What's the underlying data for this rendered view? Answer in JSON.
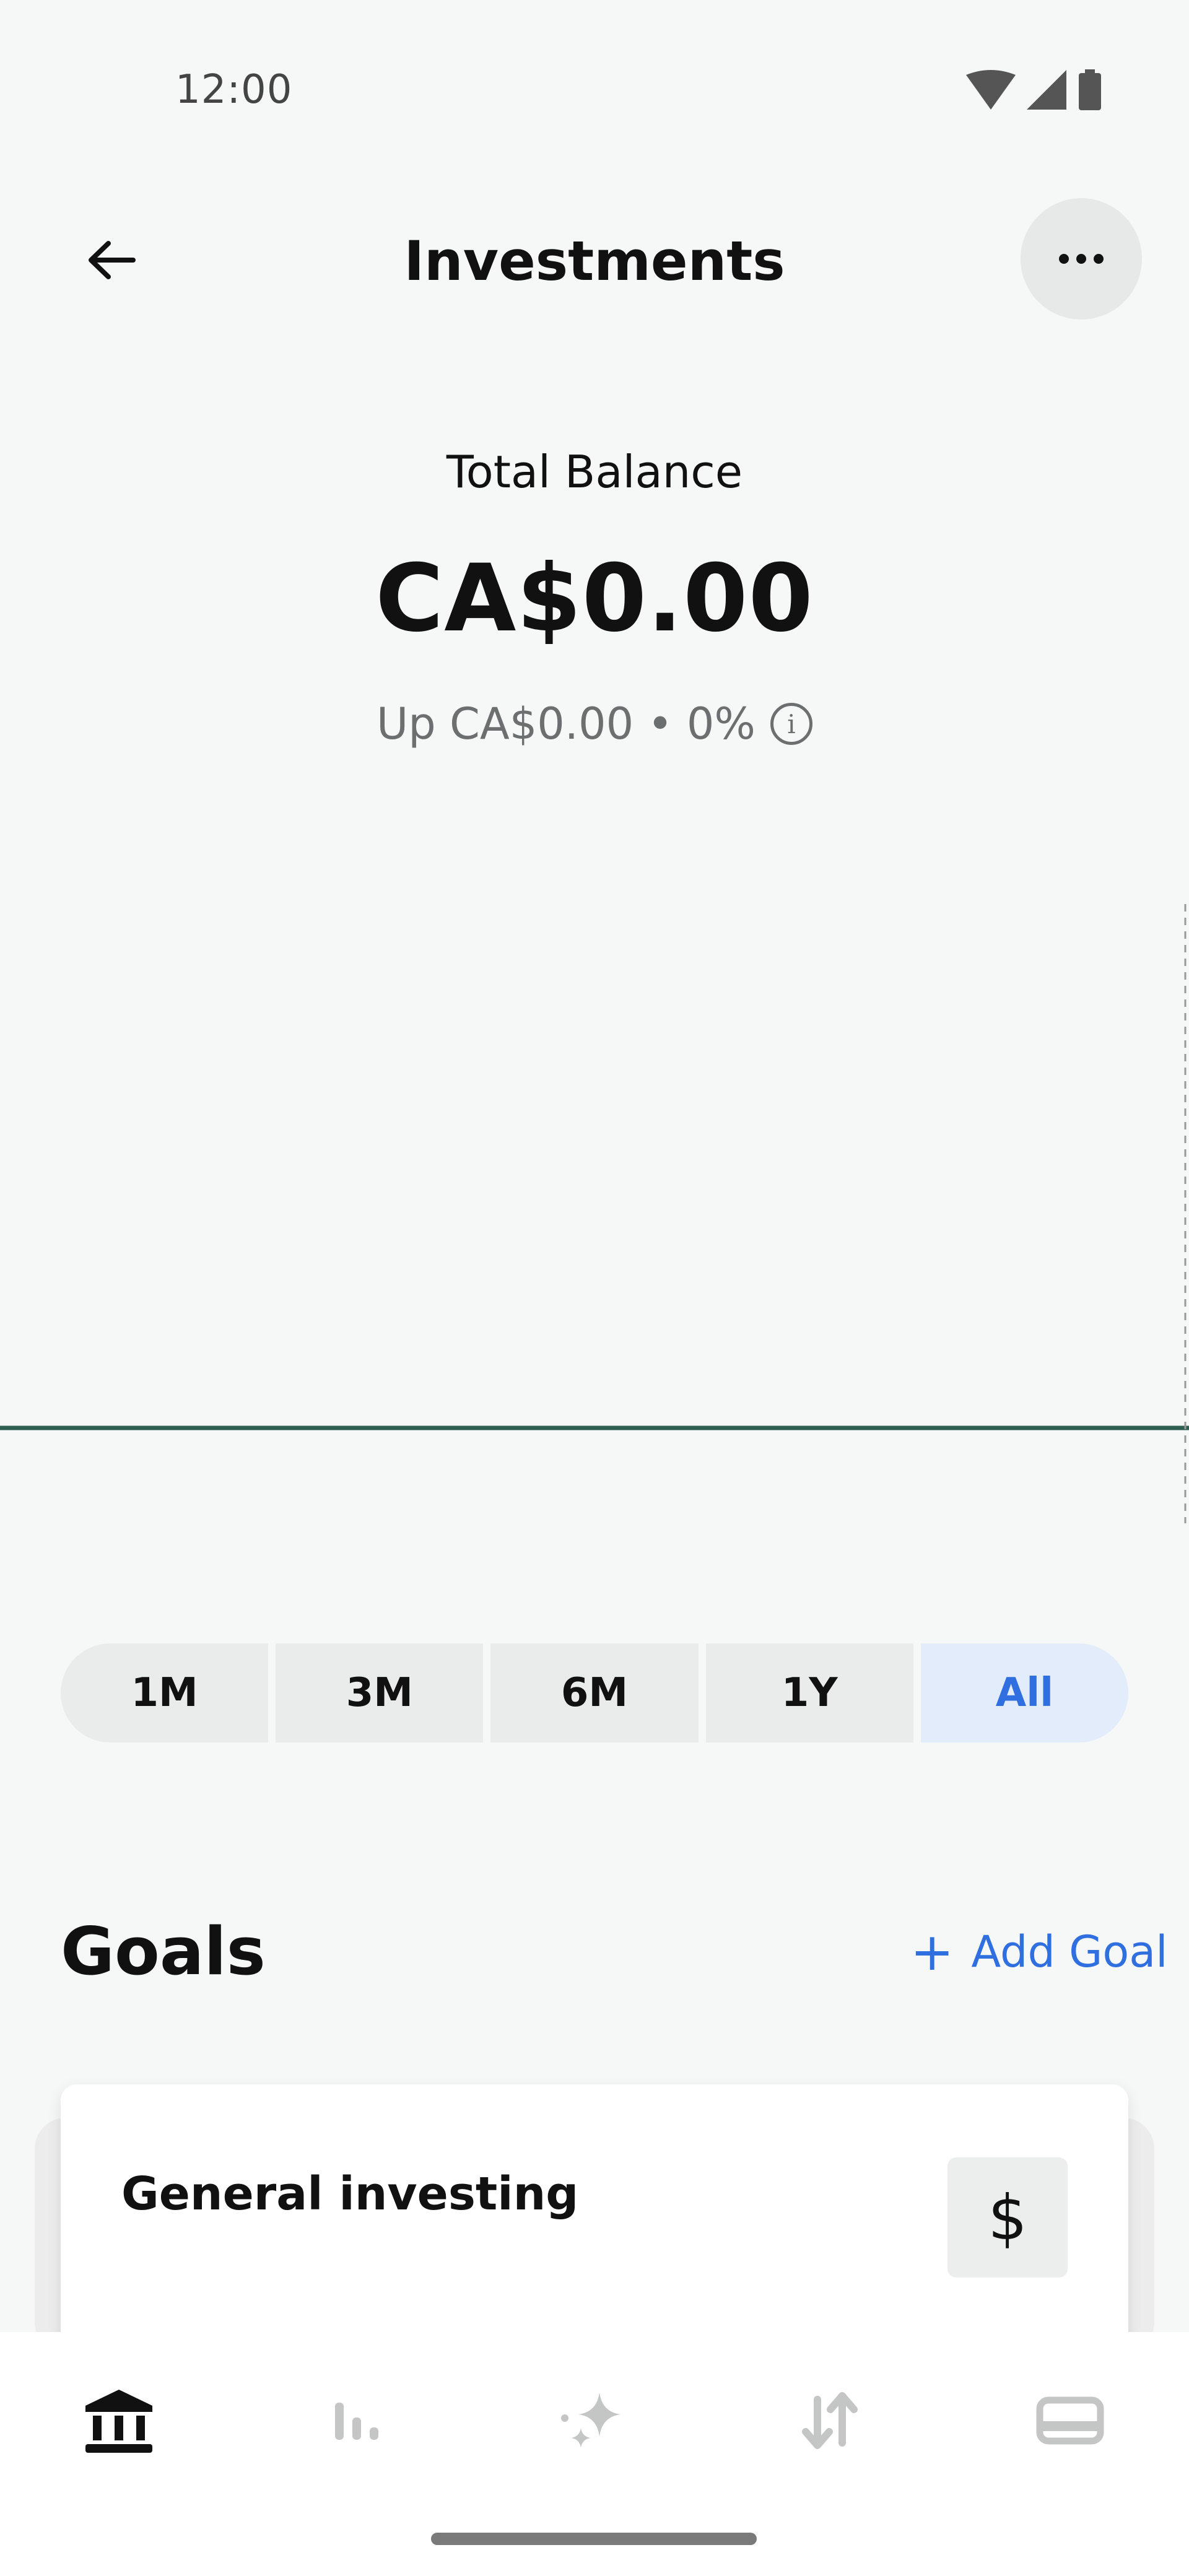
{
  "status_bar": {
    "time": "12:00"
  },
  "header": {
    "title": "Investments"
  },
  "balance": {
    "label": "Total Balance",
    "amount": "CA$0.00",
    "change": "Up CA$0.00 • 0%"
  },
  "range": {
    "options": [
      "1M",
      "3M",
      "6M",
      "1Y",
      "All"
    ],
    "selected": "All"
  },
  "goals": {
    "title": "Goals",
    "add_label": "Add Goal",
    "items": [
      {
        "name": "General investing",
        "icon": "$"
      }
    ]
  },
  "nav": {
    "items": [
      "bank-icon",
      "bar-chart-icon",
      "sparkle-icon",
      "transfer-icon",
      "card-icon"
    ]
  },
  "colors": {
    "accent": "#2f6fe0",
    "chart_line": "#2f5d4f"
  }
}
